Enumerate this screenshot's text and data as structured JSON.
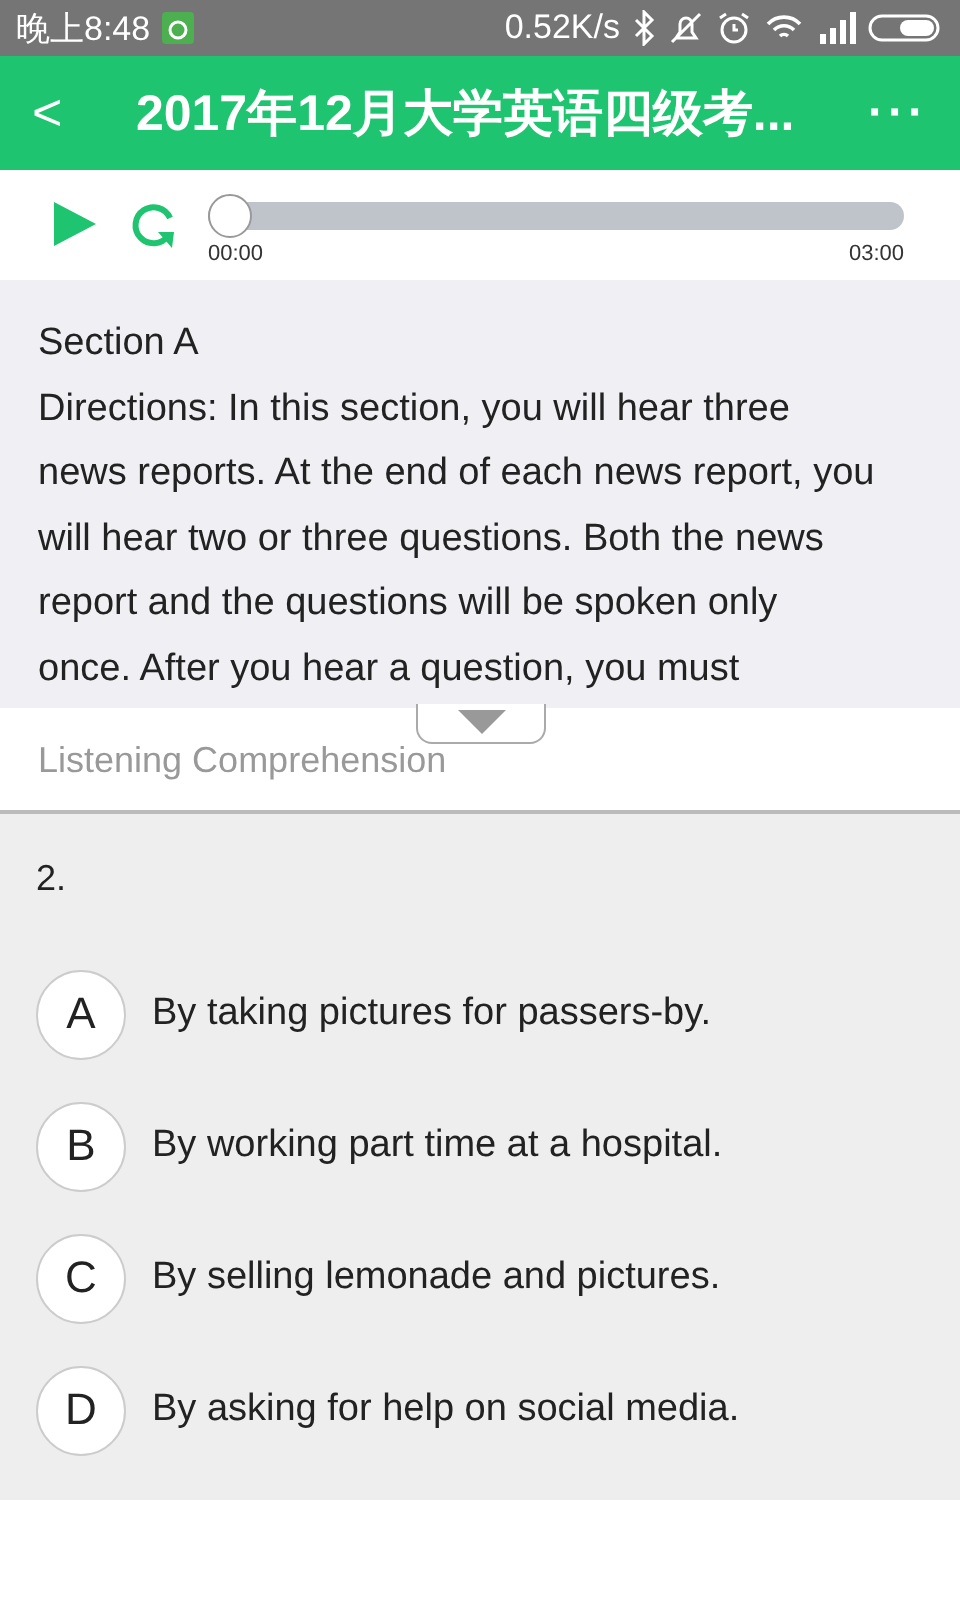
{
  "status_bar": {
    "time": "晚上8:48",
    "speed": "0.52K/s"
  },
  "header": {
    "back": "<",
    "title": "2017年12月大学英语四级考...",
    "more": "···"
  },
  "player": {
    "level": 0,
    "elapsed": "00:00",
    "total": "03:00"
  },
  "passage": {
    "heading": "Section A",
    "text": "Directions: In this section, you will hear three news reports. At the end of each news report, you will hear two or three questions. Both the news report and the questions will be spoken only once. After you hear a question, you must"
  },
  "part_label": "Listening Comprehension",
  "question": {
    "number": "2.",
    "options": [
      {
        "letter": "A",
        "text": "By taking pictures for passers-by.",
        "selected": false
      },
      {
        "letter": "B",
        "text": "By working part time at a hospital.",
        "selected": false
      },
      {
        "letter": "C",
        "text": "By selling lemonade and pictures.",
        "selected": false
      },
      {
        "letter": "D",
        "text": "By asking for help on social media.",
        "selected": false
      }
    ]
  }
}
